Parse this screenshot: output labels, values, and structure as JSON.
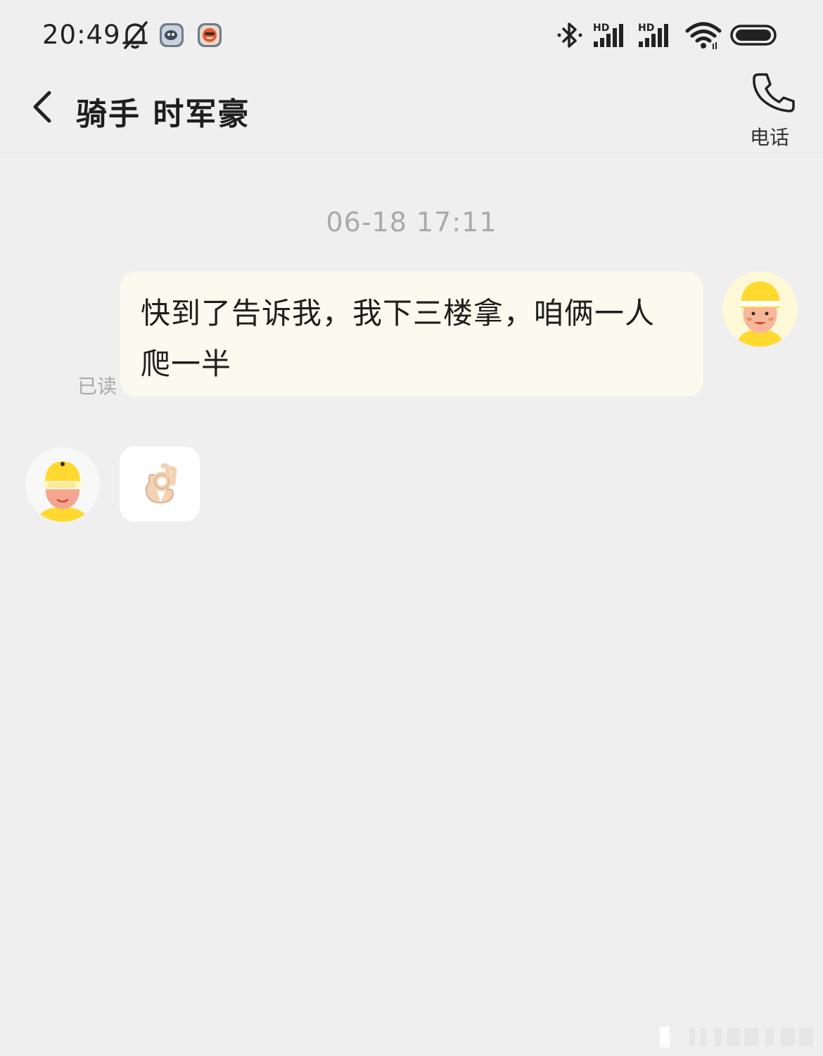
{
  "status_bar": {
    "time": "20:49",
    "icons": [
      "bell-mute-icon",
      "app-notification-icon",
      "app-notification-icon",
      "bluetooth-icon",
      "hd-signal-icon",
      "hd-signal-icon",
      "wifi-icon",
      "battery-icon"
    ],
    "hd_label": "HD"
  },
  "header": {
    "back_icon": "chevron-left-icon",
    "title": "骑手 时军豪",
    "call_icon": "phone-icon",
    "call_label": "电话"
  },
  "chat": {
    "timestamp": "06-18 17:11",
    "messages": [
      {
        "direction": "outgoing",
        "text": "快到了告诉我，我下三楼拿，咱俩一人爬一半",
        "status": "已读"
      },
      {
        "direction": "incoming",
        "emoji": "ok-hand-emoji"
      }
    ]
  },
  "colors": {
    "background": "#efefef",
    "outgoing_bubble": "#fcfaee",
    "incoming_bubble": "#ffffff",
    "avatar_helmet": "#ffd92e"
  }
}
